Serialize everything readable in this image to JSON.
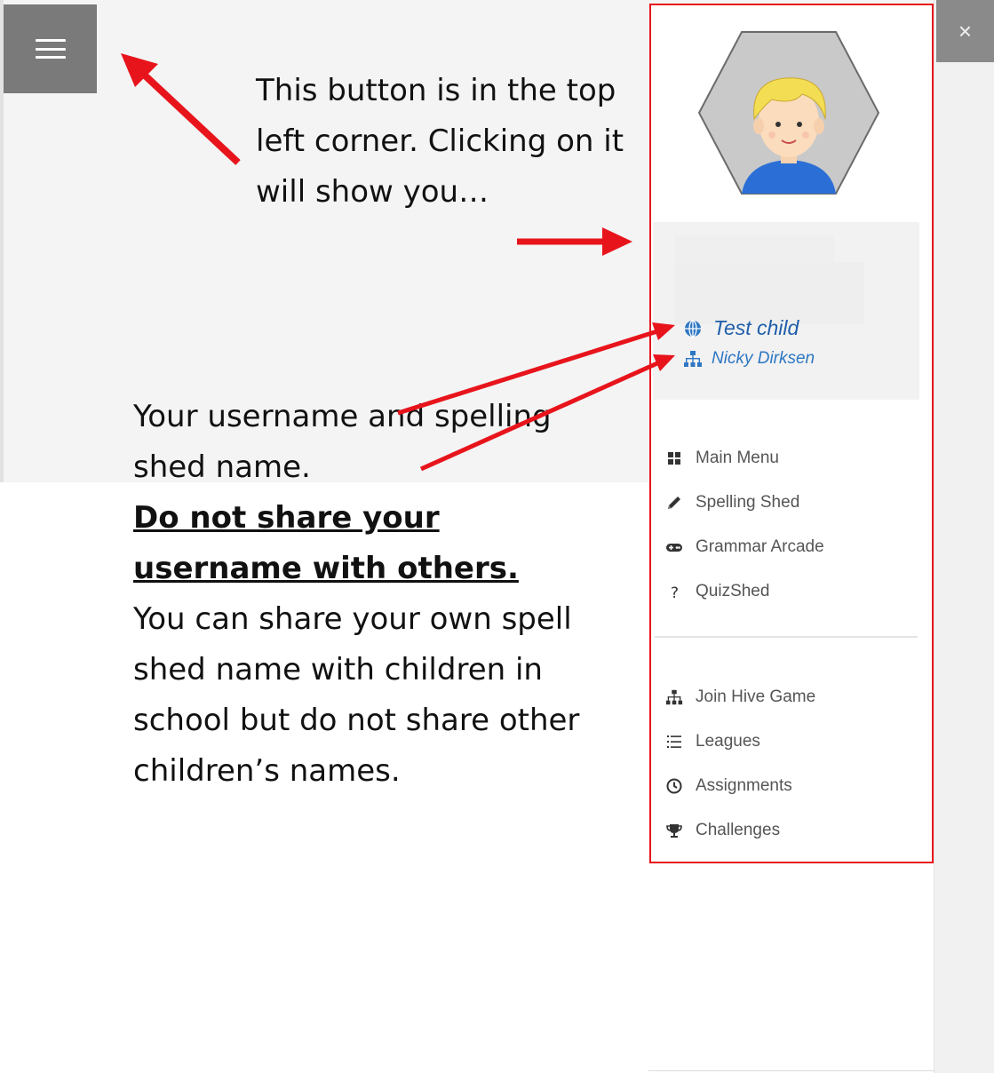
{
  "annotations": {
    "top": "This button is in the top left corner. Clicking on it will show you…",
    "left_intro": "Your username and spelling shed name.",
    "left_warning": "Do not share your username with others.",
    "left_body": "You can share your own spell shed name with children in school but do not share other children’s names."
  },
  "window": {
    "close_label": "×"
  },
  "user": {
    "username": "Test child",
    "shed_name": "Nicky Dirksen"
  },
  "menu_primary": [
    {
      "label": "Main Menu",
      "icon": "grid-icon"
    },
    {
      "label": "Spelling Shed",
      "icon": "pencil-icon"
    },
    {
      "label": "Grammar Arcade",
      "icon": "gamepad-icon"
    },
    {
      "label": "QuizShed",
      "icon": "question-icon"
    }
  ],
  "menu_secondary": [
    {
      "label": "Join Hive Game",
      "icon": "hive-network-icon"
    },
    {
      "label": "Leagues",
      "icon": "list-icon"
    },
    {
      "label": "Assignments",
      "icon": "clock-icon"
    },
    {
      "label": "Challenges",
      "icon": "trophy-icon"
    }
  ],
  "colors": {
    "annotation_red": "#e8141c",
    "link_blue": "#1e5eaa",
    "menu_text": "#555555"
  }
}
